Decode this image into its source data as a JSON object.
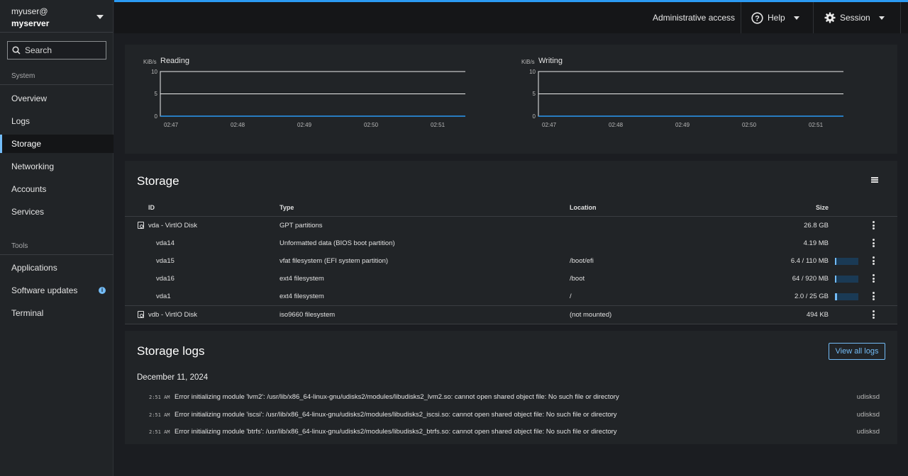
{
  "host": {
    "user": "myuser@",
    "server": "myserver"
  },
  "search": {
    "label": "Search"
  },
  "sidebar": {
    "system_label": "System",
    "tools_label": "Tools",
    "system_items": [
      "Overview",
      "Logs",
      "Storage",
      "Networking",
      "Accounts",
      "Services"
    ],
    "tools_items": [
      "Applications",
      "Software updates",
      "Terminal"
    ],
    "active": "Storage"
  },
  "topbar": {
    "admin": "Administrative access",
    "help": "Help",
    "session": "Session"
  },
  "charts": {
    "reading": {
      "title": "Reading",
      "unit": "KiB/s"
    },
    "writing": {
      "title": "Writing",
      "unit": "KiB/s"
    },
    "y_ticks": [
      "10",
      "5",
      "0"
    ],
    "x_ticks": [
      "02:47",
      "02:48",
      "02:49",
      "02:50",
      "02:51"
    ]
  },
  "storage": {
    "title": "Storage",
    "headers": {
      "id": "ID",
      "type": "Type",
      "location": "Location",
      "size": "Size"
    },
    "rows": [
      {
        "id": "vda - VirtIO Disk",
        "type": "GPT partitions",
        "location": "",
        "size": "26.8 GB",
        "disk": true,
        "usage": null
      },
      {
        "id": "vda14",
        "type": "Unformatted data (BIOS boot partition)",
        "location": "",
        "size": "4.19 MB",
        "disk": false,
        "usage": null
      },
      {
        "id": "vda15",
        "type": "vfat filesystem (EFI system partition)",
        "location": "/boot/efi",
        "size": "6.4 / 110 MB",
        "disk": false,
        "usage": 0.058
      },
      {
        "id": "vda16",
        "type": "ext4 filesystem",
        "location": "/boot",
        "size": "64 / 920 MB",
        "disk": false,
        "usage": 0.07
      },
      {
        "id": "vda1",
        "type": "ext4 filesystem",
        "location": "/",
        "size": "2.0 / 25 GB",
        "disk": false,
        "usage": 0.08
      },
      {
        "id": "vdb - VirtIO Disk",
        "type": "iso9660 filesystem",
        "location": "(not mounted)",
        "size": "494 KB",
        "disk": true,
        "usage": null
      }
    ]
  },
  "logs": {
    "title": "Storage logs",
    "view_all": "View all logs",
    "date": "December 11, 2024",
    "entries": [
      {
        "time": "2:51 AM",
        "message": "Error initializing module 'lvm2': /usr/lib/x86_64-linux-gnu/udisks2/modules/libudisks2_lvm2.so: cannot open shared object file: No such file or directory",
        "source": "udisksd"
      },
      {
        "time": "2:51 AM",
        "message": "Error initializing module 'iscsi': /usr/lib/x86_64-linux-gnu/udisks2/modules/libudisks2_iscsi.so: cannot open shared object file: No such file or directory",
        "source": "udisksd"
      },
      {
        "time": "2:51 AM",
        "message": "Error initializing module 'btrfs': /usr/lib/x86_64-linux-gnu/udisks2/modules/libudisks2_btrfs.so: cannot open shared object file: No such file or directory",
        "source": "udisksd"
      }
    ]
  },
  "colors": {
    "accent": "#73bcf7",
    "topbar_line": "#2b9af3",
    "background": "#1b1d21",
    "card": "#212427"
  }
}
